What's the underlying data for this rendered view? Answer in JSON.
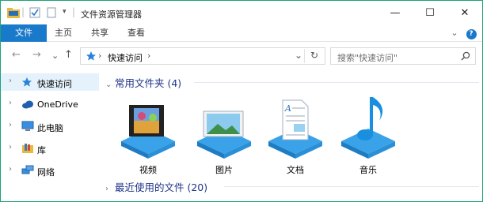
{
  "window": {
    "title": "文件资源管理器",
    "controls": {
      "minimize": "—",
      "maximize": "☐",
      "close": "✕"
    }
  },
  "ribbon": {
    "tabs": [
      {
        "label": "文件"
      },
      {
        "label": "主页"
      },
      {
        "label": "共享"
      },
      {
        "label": "查看"
      }
    ],
    "expand_glyph": "⌄",
    "help_glyph": "?"
  },
  "nav": {
    "back": "←",
    "forward": "→",
    "recent": "⌄",
    "up": "↑",
    "address": {
      "location": "快速访问",
      "separator": "›",
      "dropdown": "⌄",
      "refresh": "↻"
    },
    "search": {
      "placeholder": "搜索\"快速访问\""
    }
  },
  "sidebar": {
    "items": [
      {
        "label": "快速访问",
        "icon": "star-pin-icon",
        "selected": true
      },
      {
        "label": "OneDrive",
        "icon": "cloud-icon",
        "selected": false
      },
      {
        "label": "此电脑",
        "icon": "computer-icon",
        "selected": false
      },
      {
        "label": "库",
        "icon": "library-icon",
        "selected": false
      },
      {
        "label": "网络",
        "icon": "network-icon",
        "selected": false
      }
    ],
    "chevron": "›"
  },
  "main": {
    "frequent": {
      "title": "常用文件夹 (4)",
      "chevron": "⌄"
    },
    "folders": [
      {
        "label": "视频",
        "icon": "video-film-icon"
      },
      {
        "label": "图片",
        "icon": "picture-icon"
      },
      {
        "label": "文档",
        "icon": "document-icon"
      },
      {
        "label": "音乐",
        "icon": "music-note-icon"
      }
    ],
    "recent": {
      "title": "最近使用的文件 (20)",
      "chevron": "›"
    }
  },
  "colors": {
    "accent": "#1979ca",
    "border": "#1da37a",
    "group_header": "#1e3287",
    "selection": "#e5f1fb"
  }
}
